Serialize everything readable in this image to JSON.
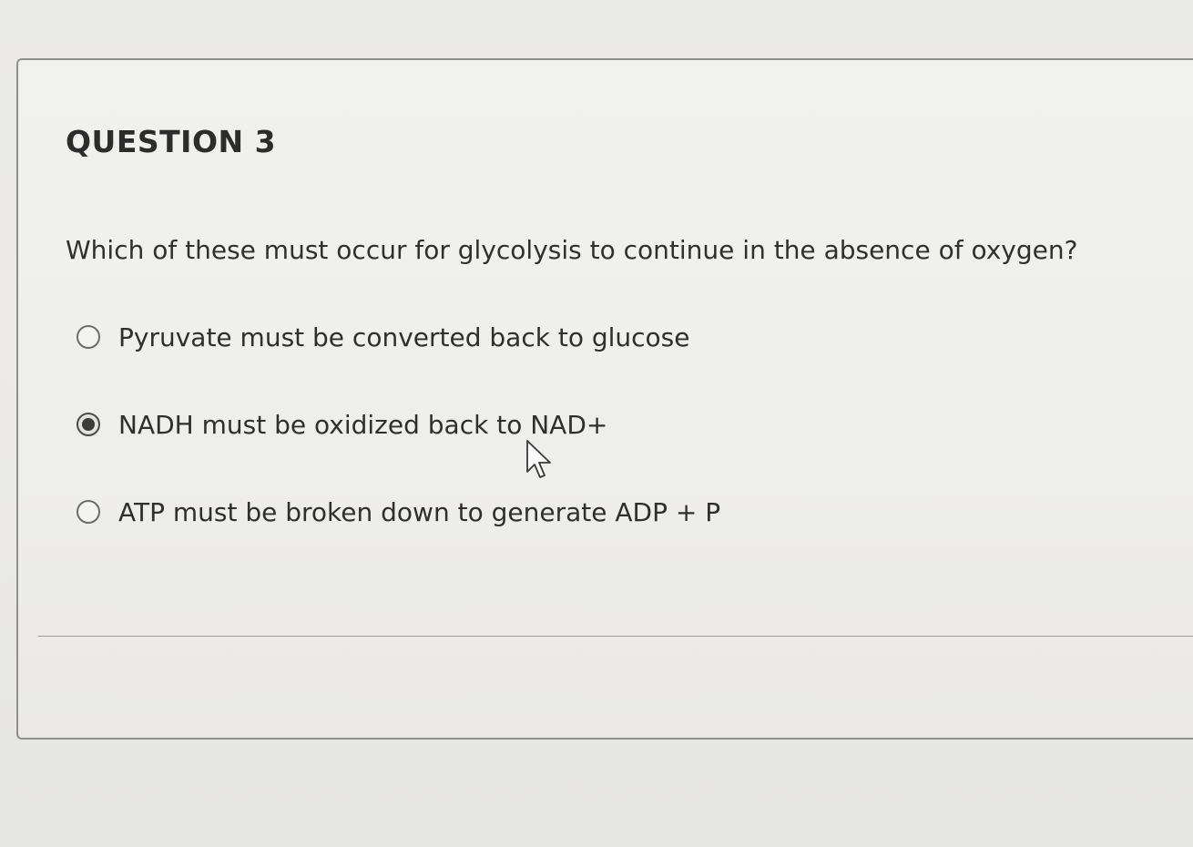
{
  "question": {
    "title": "QUESTION 3",
    "text": "Which of these must occur for glycolysis to continue in the absence of oxygen?",
    "options": [
      {
        "label": "Pyruvate must be converted back to glucose",
        "selected": false
      },
      {
        "label": "NADH must be oxidized back to NAD+",
        "selected": true
      },
      {
        "label": "ATP must be broken down to generate ADP + P",
        "selected": false
      }
    ]
  },
  "icons": {
    "cursor": "mouse-pointer-icon"
  },
  "colors": {
    "background": "#ebeae7",
    "card_border": "#8f8f8c",
    "text": "#2f2f2f"
  }
}
